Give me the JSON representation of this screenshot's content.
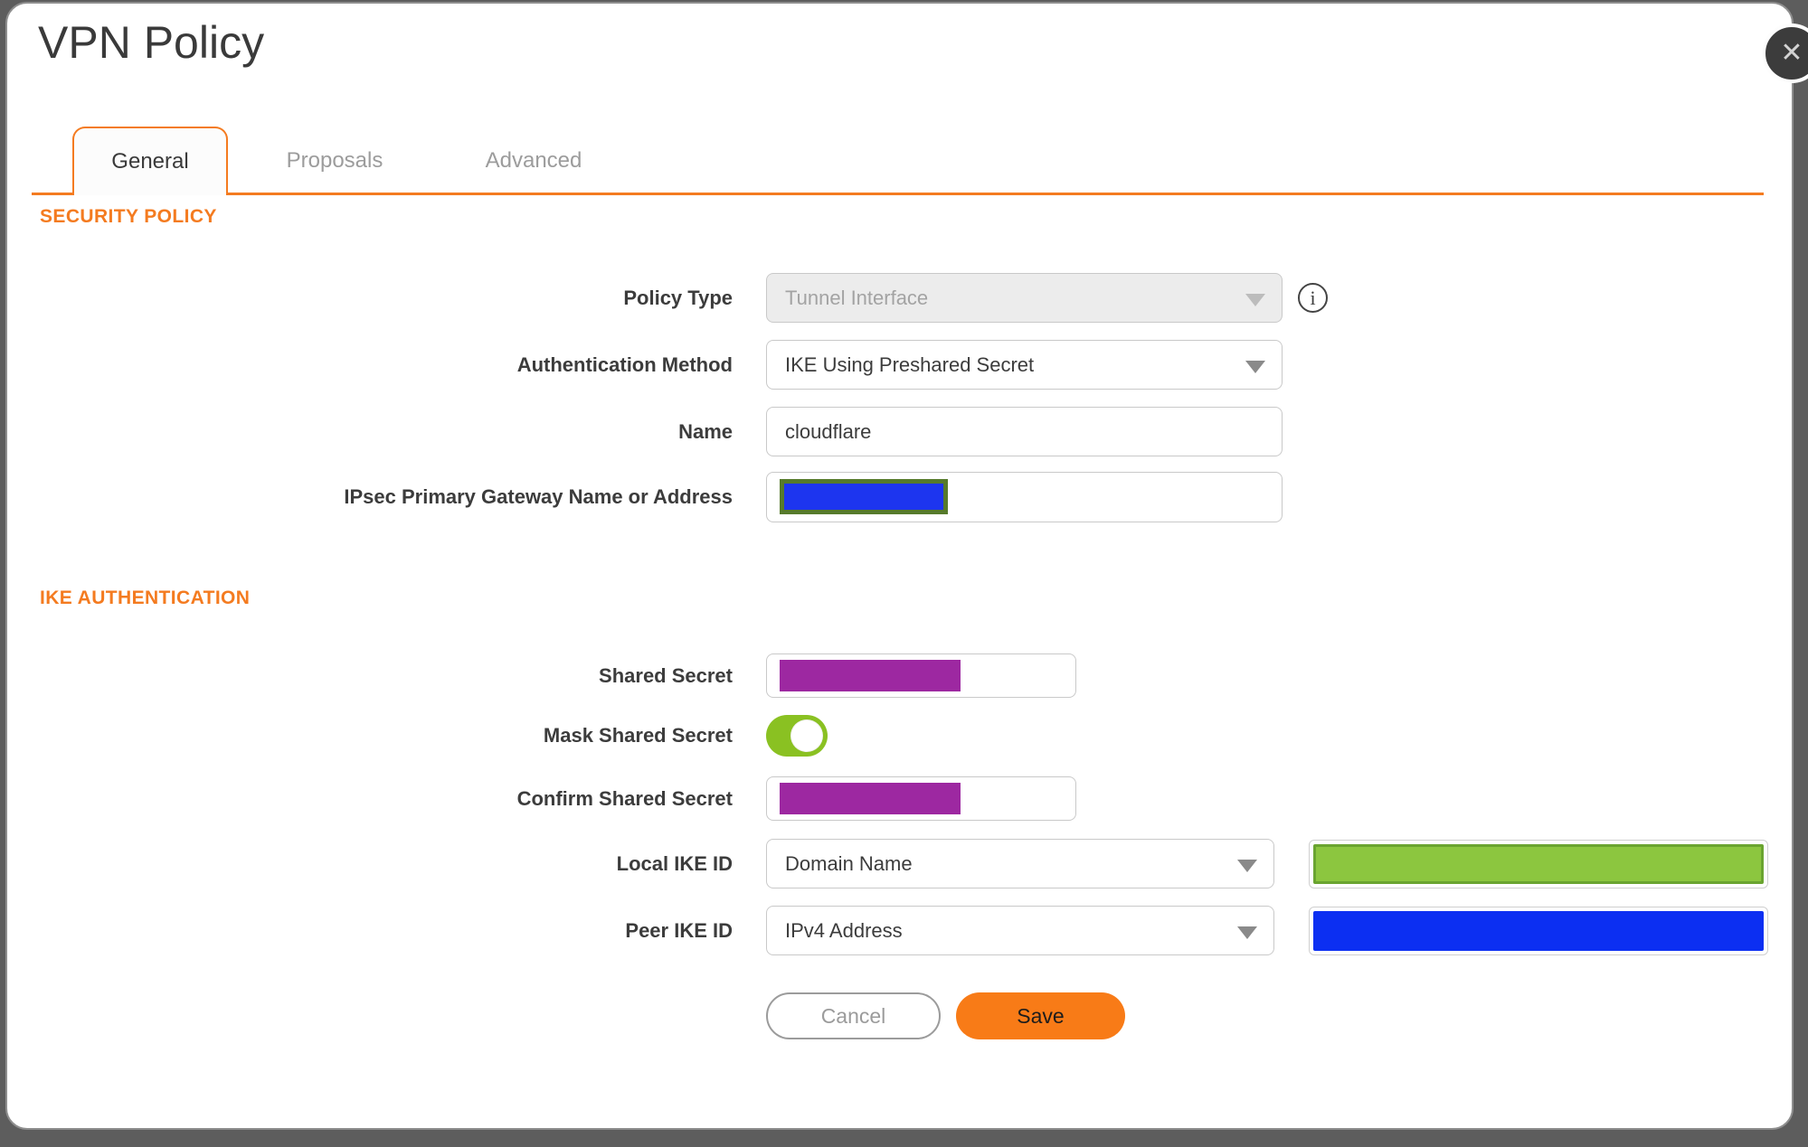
{
  "dialog": {
    "title": "VPN Policy",
    "close_icon": "✕",
    "tabs": [
      {
        "label": "General",
        "active": true
      },
      {
        "label": "Proposals",
        "active": false
      },
      {
        "label": "Advanced",
        "active": false
      }
    ]
  },
  "security_policy": {
    "heading": "SECURITY POLICY",
    "policy_type": {
      "label": "Policy Type",
      "value": "Tunnel Interface",
      "disabled": true,
      "info_icon": "info-circled-i"
    },
    "authentication_method": {
      "label": "Authentication Method",
      "value": "IKE Using Preshared Secret"
    },
    "name": {
      "label": "Name",
      "value": "cloudflare"
    },
    "gateway": {
      "label": "IPsec Primary Gateway Name or Address",
      "value_redacted": true
    }
  },
  "ike_authentication": {
    "heading": "IKE AUTHENTICATION",
    "shared_secret": {
      "label": "Shared Secret",
      "value_redacted": true
    },
    "mask_shared_secret": {
      "label": "Mask Shared Secret",
      "toggle_on": true
    },
    "confirm_shared_secret": {
      "label": "Confirm Shared Secret",
      "value_redacted": true
    },
    "local_ike_id": {
      "label": "Local IKE ID",
      "value": "Domain Name",
      "id_value_redacted": true
    },
    "peer_ike_id": {
      "label": "Peer IKE ID",
      "value": "IPv4 Address",
      "id_value_redacted": true
    }
  },
  "footer": {
    "cancel_label": "Cancel",
    "save_label": "Save"
  },
  "colors": {
    "accent": "#f47b20",
    "save": "#f87b17",
    "toggle_green": "#8ac122",
    "purple": "#9d28a1",
    "gateway_blue": "#1d35ef",
    "gateway_olive": "#567a2b",
    "local_green": "#8cc63f",
    "local_green_border": "#6aa430",
    "peer_blue": "#0c2ff2",
    "backdrop": "#5d5d5d"
  }
}
